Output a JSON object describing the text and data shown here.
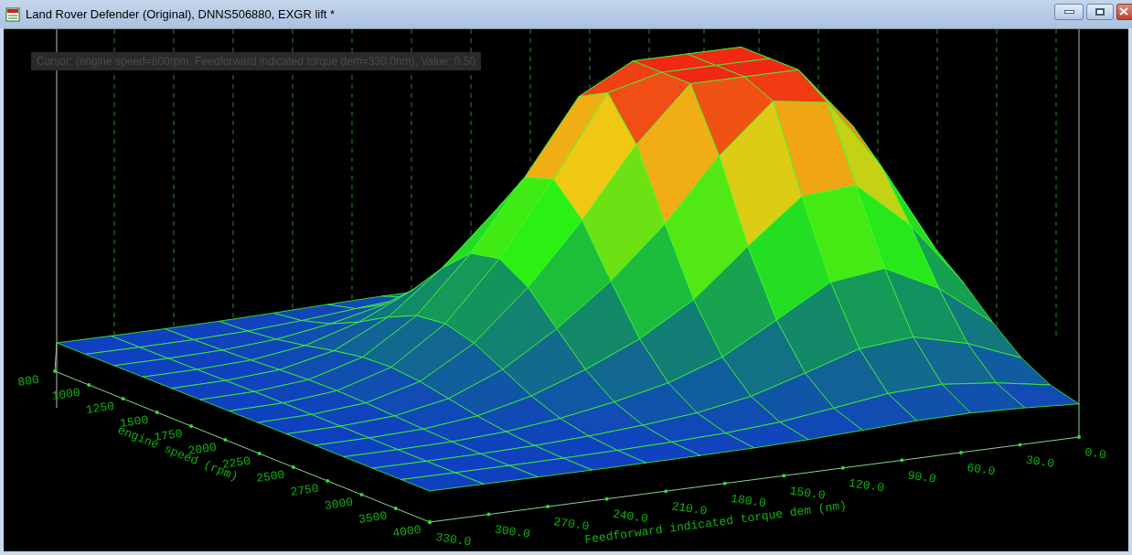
{
  "window": {
    "title": "Land Rover Defender (Original), DNNS506880, EXGR lift *"
  },
  "cursor_readout": "Cursor: (engine speed=800rpm, Feedforward indicated torque dem=330.0nm), Value: 0.50",
  "surface_plot": {
    "x_axis": {
      "title": "engine speed (rpm)",
      "ticks": [
        "800",
        "1000",
        "1250",
        "1500",
        "1750",
        "2000",
        "2250",
        "2500",
        "2750",
        "3000",
        "3500",
        "4000"
      ]
    },
    "y_axis": {
      "title": "Feedforward indicated torque dem (nm)",
      "ticks": [
        "330.0",
        "300.0",
        "270.0",
        "240.0",
        "210.0",
        "180.0",
        "150.0",
        "120.0",
        "90.0",
        "60.0",
        "30.0",
        "0.0"
      ]
    }
  }
}
